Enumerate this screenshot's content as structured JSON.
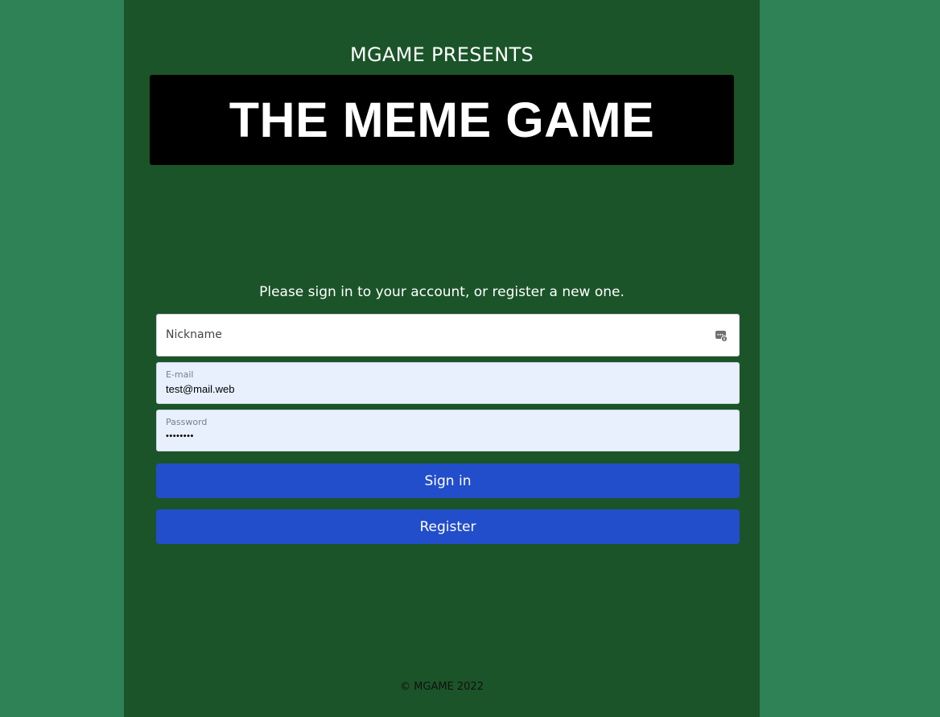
{
  "header": {
    "presents": "MGAME PRESENTS",
    "title": "THE MEME GAME"
  },
  "form": {
    "prompt": "Please sign in to your account, or register a new one.",
    "nickname": {
      "label": "Nickname",
      "value": "",
      "icon": "autofill-key-icon"
    },
    "email": {
      "label": "E-mail",
      "value": "test@mail.web"
    },
    "password": {
      "label": "Password",
      "value": "••••••••"
    },
    "signin_label": "Sign in",
    "register_label": "Register"
  },
  "footer": {
    "text": "© MGAME 2022"
  },
  "colors": {
    "page_bg": "#2e8255",
    "column_bg": "#1b5429",
    "banner_bg": "#000000",
    "button_bg": "#224ecb",
    "autofill_bg": "#e8f0fe"
  }
}
